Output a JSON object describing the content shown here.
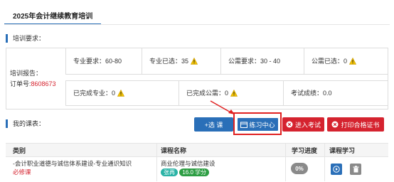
{
  "tab": {
    "label": "2025年会计继续教育培训"
  },
  "requirements": {
    "section_title": "培训要求：",
    "report_label": "培训报告：",
    "order_label": "订单号:",
    "order_number": "8608673",
    "prof_required": "专业要求：60-80",
    "prof_selected_label": "专业已选：",
    "prof_selected_value": "35",
    "public_required": "公需要求：30 - 40",
    "public_selected_label": "公需已选：",
    "public_selected_value": "0",
    "prof_completed_label": "已完成专业：",
    "prof_completed_value": "0",
    "public_completed_label": "已完成公需：",
    "public_completed_value": "0",
    "exam_score_label": "考试成绩：",
    "exam_score_value": "0.0"
  },
  "courses": {
    "section_title": "我的课表：",
    "buttons": {
      "select_course": "+选 课",
      "practice_center": "练习中心",
      "enter_exam": "进入考试",
      "print_certificate": "打印合格证书"
    },
    "columns": [
      "类别",
      "课程名称",
      "学习进度",
      "课程学习"
    ],
    "rows": [
      {
        "category": "-会计职业道德与诚信体系建设-专业通识知识",
        "required": "必修课",
        "course_name": "商业伦理与诚信建设",
        "tag_type": "张再",
        "tag_hours": "16.0 学分",
        "progress": "0%"
      }
    ]
  },
  "colors": {
    "accent": "#2a6fb8",
    "red": "#d5232f",
    "warn": "#f0c000",
    "green": "#2e9e44",
    "teal": "#2ab3a6"
  }
}
